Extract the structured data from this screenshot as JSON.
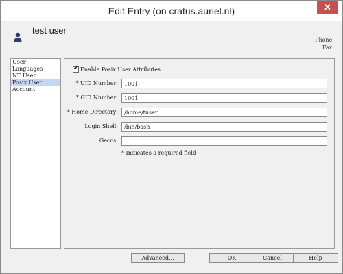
{
  "window": {
    "title": "Edit Entry (on cratus.auriel.nl)",
    "close_label": "✕"
  },
  "header": {
    "user_name": "test user",
    "phone_label": "Phone:",
    "fax_label": "Fax:"
  },
  "sidebar": {
    "items": [
      {
        "label": "User",
        "selected": false
      },
      {
        "label": "Languages",
        "selected": false
      },
      {
        "label": "NT User",
        "selected": false
      },
      {
        "label": "Posix User",
        "selected": true
      },
      {
        "label": "Account",
        "selected": false
      }
    ]
  },
  "form": {
    "enable_label": "Enable Posix User Attributes",
    "enable_checked": true,
    "fields": [
      {
        "label": "* UID Number:",
        "value": "1001"
      },
      {
        "label": "* GID Number:",
        "value": "1001"
      },
      {
        "label": "* Home Directory:",
        "value": "/home/tuser"
      },
      {
        "label": "Login Shell:",
        "value": "/bin/bash"
      },
      {
        "label": "Gecos:",
        "value": ""
      }
    ],
    "required_note": "* Indicates a required field"
  },
  "buttons": {
    "advanced": "Advanced...",
    "ok": "OK",
    "cancel": "Cancel",
    "help": "Help"
  }
}
